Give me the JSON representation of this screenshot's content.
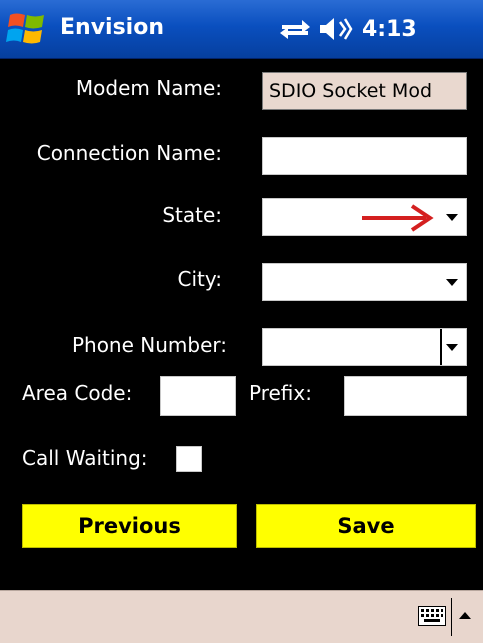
{
  "titlebar": {
    "app_title": "Envision",
    "clock": "4:13",
    "start_icon": "windows-flag-icon",
    "connectivity_icon": "connectivity-arrows-icon",
    "volume_icon": "speaker-icon"
  },
  "form": {
    "modem_name_label": "Modem Name:",
    "modem_name_value": "SDIO Socket Mod",
    "connection_name_label": "Connection Name:",
    "connection_name_value": "",
    "state_label": "State:",
    "state_value": "",
    "city_label": "City:",
    "city_value": "",
    "phone_number_label": "Phone Number:",
    "phone_number_value": "",
    "area_code_label": "Area Code:",
    "area_code_value": "",
    "prefix_label": "Prefix:",
    "prefix_value": "",
    "call_waiting_label": "Call Waiting:",
    "call_waiting_checked": false
  },
  "buttons": {
    "previous_label": "Previous",
    "save_label": "Save"
  },
  "annotation": {
    "arrow_color": "#d42020",
    "arrow_icon": "red-arrow-icon"
  },
  "menubar": {
    "keyboard_icon": "keyboard-icon",
    "sip_arrow_icon": "caret-up-icon"
  },
  "colors": {
    "titlebar_blue": "#0a4fbf",
    "button_yellow": "#ffff00",
    "menubar_bg": "#e8d6cd",
    "readonly_field_bg": "#e9d8cf"
  }
}
